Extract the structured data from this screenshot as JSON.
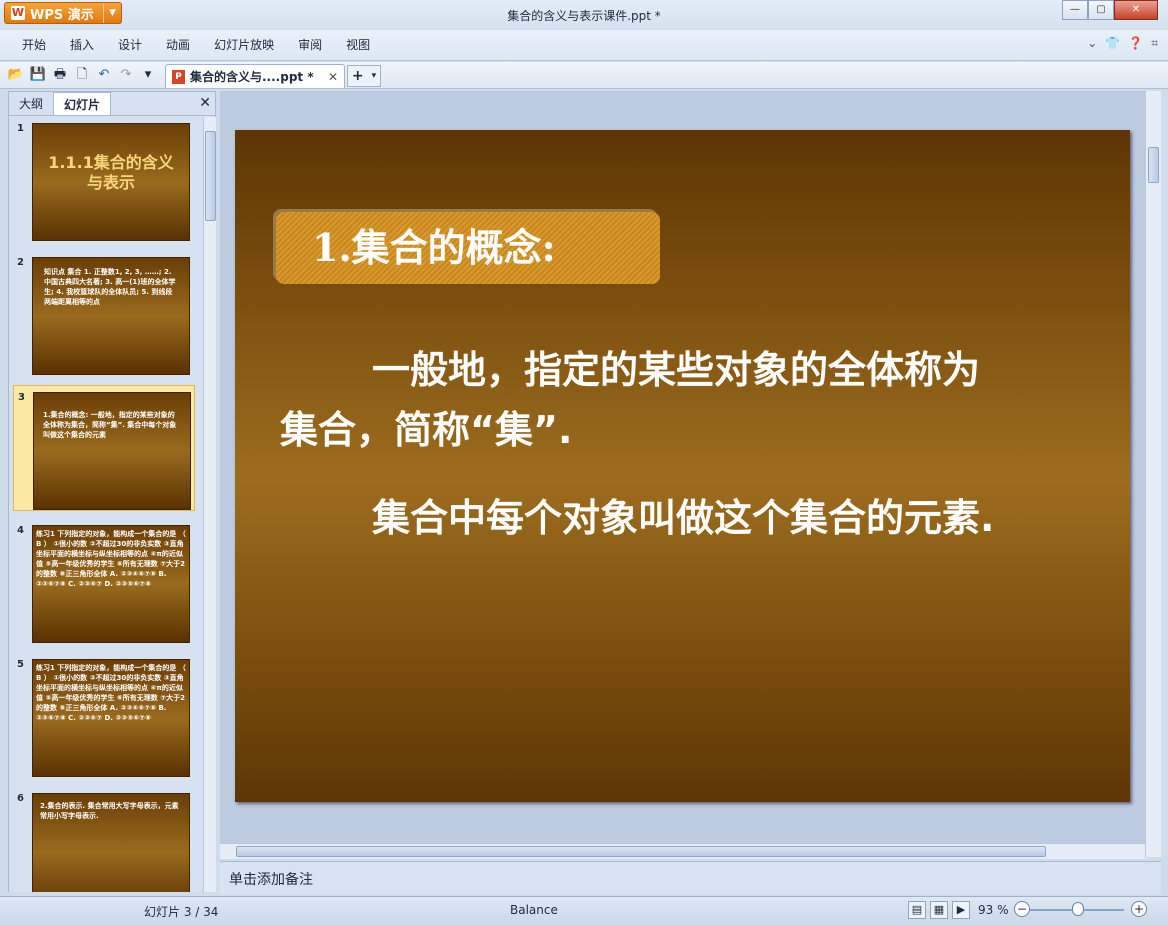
{
  "app": {
    "name": "WPS 演示",
    "window_title": "集合的含义与表示课件.ppt *"
  },
  "menu": [
    "开始",
    "插入",
    "设计",
    "动画",
    "幻灯片放映",
    "审阅",
    "视图"
  ],
  "document_tab": {
    "label": "集合的含义与....ppt *"
  },
  "panel": {
    "tabs": [
      "大纲",
      "幻灯片"
    ],
    "active_tab": "幻灯片"
  },
  "thumbnails": [
    {
      "num": "1",
      "text": "1.1.1集合的含义与表示"
    },
    {
      "num": "2",
      "text": "知识点 集合 1. 正整数1, 2, 3, ……; 2. 中国古典四大名著; 3. 高一(1)班的全体学生; 4. 我校篮球队的全体队员; 5. 到线段两端距离相等的点"
    },
    {
      "num": "3",
      "text": "1.集合的概念: 一般地，指定的某些对象的全体称为集合，简称“集”. 集合中每个对象叫做这个集合的元素"
    },
    {
      "num": "4",
      "text": "练习1 下列指定的对象，能构成一个集合的是 （ B ） ①很小的数 ②不超过30的非负实数 ③直角坐标平面的横坐标与纵坐标相等的点 ④π的近似值 ⑤高一年级优秀的学生 ⑥所有无理数 ⑦大于2的整数 ⑧正三角形全体 A. ②③④⑥⑦⑧ B. ②③⑥⑦⑧ C. ②③⑥⑦ D. ②③⑤⑥⑦⑧"
    },
    {
      "num": "5",
      "text": "练习1 下列指定的对象，能构成一个集合的是 （ B ） ①很小的数 ②不超过30的非负实数 ③直角坐标平面的横坐标与纵坐标相等的点 ④π的近似值 ⑤高一年级优秀的学生 ⑥所有无理数 ⑦大于2的整数 ⑧正三角形全体 A. ②③④⑥⑦⑧ B. ②③⑥⑦⑧ C. ②③⑥⑦ D. ②③⑤⑥⑦⑧"
    },
    {
      "num": "6",
      "text": "2.集合的表示. 集合常用大写字母表示，元素常用小写字母表示."
    }
  ],
  "selected_thumbnail": 3,
  "slide": {
    "title": "1.集合的概念:",
    "paragraphs": [
      "一般地，指定的某些对象的全体称为集合，简称“集”.",
      "集合中每个对象叫做这个集合的元素."
    ]
  },
  "notes_placeholder": "单击添加备注",
  "status": {
    "slide_counter": "幻灯片 3 / 34",
    "theme": "Balance",
    "zoom": "93 %"
  }
}
